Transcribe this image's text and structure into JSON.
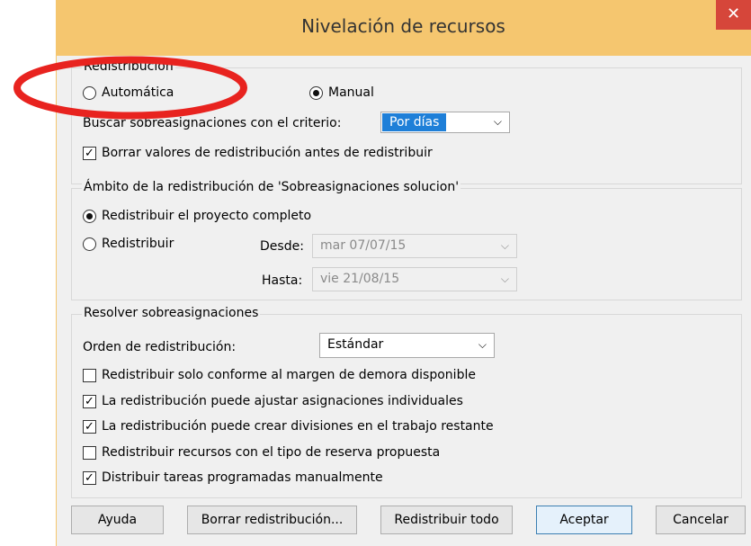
{
  "window": {
    "title": "Nivelación de recursos",
    "close_label": "✕"
  },
  "redistribucion": {
    "legend": "Redistribución",
    "option_auto": "Automática",
    "option_manual": "Manual",
    "selected": "manual",
    "criteria_label": "Buscar sobreasignaciones con el criterio:",
    "criteria_value": "Por días",
    "clear_values_label": "Borrar valores de redistribución antes de redistribuir",
    "clear_values_checked": true
  },
  "ambito": {
    "legend": "Ámbito de la redistribución de 'Sobreasignaciones solucion'",
    "option_full": "Redistribuir el proyecto completo",
    "option_range": "Redistribuir",
    "selected": "full",
    "from_label": "Desde:",
    "from_value": "mar 07/07/15",
    "to_label": "Hasta:",
    "to_value": "vie 21/08/15"
  },
  "resolver": {
    "legend": "Resolver sobreasignaciones",
    "order_label": "Orden de redistribución:",
    "order_value": "Estándar",
    "options": [
      {
        "label": "Redistribuir solo conforme al margen de demora disponible",
        "checked": false
      },
      {
        "label": "La redistribución puede ajustar asignaciones individuales",
        "checked": true
      },
      {
        "label": "La redistribución puede crear divisiones en el trabajo restante",
        "checked": true
      },
      {
        "label": "Redistribuir recursos con el tipo de reserva propuesta",
        "checked": false
      },
      {
        "label": "Distribuir tareas programadas manualmente",
        "checked": true
      }
    ]
  },
  "buttons": {
    "help": "Ayuda",
    "clear": "Borrar redistribución...",
    "level_all": "Redistribuir todo",
    "ok": "Aceptar",
    "cancel": "Cancelar"
  },
  "icons": {
    "dropdown": "chevron-down-icon",
    "check": "checkmark-icon"
  },
  "colors": {
    "titlebar": "#f5c66f",
    "close": "#d6463a",
    "highlight": "#1e7fd8",
    "annotation": "#e8231f"
  }
}
